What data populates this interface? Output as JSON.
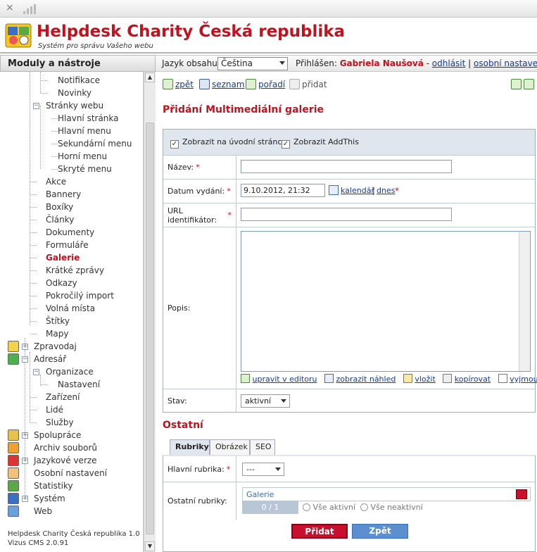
{
  "app": {
    "title": "Helpdesk Charity Česká republika",
    "subtitle": "Systém pro správu Vašeho webu"
  },
  "browser": {
    "close_glyph": "×"
  },
  "sidebar": {
    "header": "Moduly a nástroje",
    "items": [
      {
        "label": "Notifikace"
      },
      {
        "label": "Novinky"
      },
      {
        "label": "Stránky webu"
      },
      {
        "label": "Hlavní stránka"
      },
      {
        "label": "Hlavní menu"
      },
      {
        "label": "Sekundární menu"
      },
      {
        "label": "Horní menu"
      },
      {
        "label": "Skryté menu"
      },
      {
        "label": "Akce"
      },
      {
        "label": "Bannery"
      },
      {
        "label": "Boxíky"
      },
      {
        "label": "Články"
      },
      {
        "label": "Dokumenty"
      },
      {
        "label": "Formuláře"
      },
      {
        "label": "Galerie",
        "active": true
      },
      {
        "label": "Krátké zprávy"
      },
      {
        "label": "Odkazy"
      },
      {
        "label": "Pokročilý import"
      },
      {
        "label": "Volná místa"
      },
      {
        "label": "Štítky"
      },
      {
        "label": "Mapy"
      },
      {
        "label": "Zpravodaj"
      },
      {
        "label": "Adresář"
      },
      {
        "label": "Organizace"
      },
      {
        "label": "Nastavení"
      },
      {
        "label": "Zařízení"
      },
      {
        "label": "Lidé"
      },
      {
        "label": "Služby"
      },
      {
        "label": "Spolupráce"
      },
      {
        "label": "Archiv souborů"
      },
      {
        "label": "Jazykové verze"
      },
      {
        "label": "Osobní nastavení"
      },
      {
        "label": "Statistiky"
      },
      {
        "label": "Systém"
      },
      {
        "label": "Web"
      }
    ],
    "footer_line1": "Helpdesk Charity Česká republika 1.0",
    "footer_line2": "Vizus CMS 2.0.91"
  },
  "langbar": {
    "label": "Jazyk obsahu:",
    "selected": "Čeština",
    "logged_label": "Přihlášen:",
    "user": "Gabriela Naušová",
    "separator1": "-",
    "logout": "odhlásit",
    "separator2": "|",
    "settings": "osobní nastavení"
  },
  "toolbar": {
    "back": "zpět",
    "list": "seznam",
    "order": "pořadí",
    "add": "přidat"
  },
  "page_title": "Přidání Multimediální galerie",
  "form": {
    "show_home_label": "Zobrazit na úvodní stránce",
    "show_home_checked": true,
    "show_addthis_label": "Zobrazit AddThis",
    "show_addthis_checked": true,
    "name_label": "Název:",
    "name_value": "",
    "date_label": "Datum vydání:",
    "date_value": "9.10.2012, 21:32",
    "calendar_link": "kalendář",
    "date_sep": "|",
    "today_link": "dnes",
    "url_label": "URL identifikátor:",
    "url_value": "",
    "desc_label": "Popis:",
    "desc_value": "",
    "req_mark": "*",
    "editor_links": {
      "edit": "upravit v editoru",
      "preview": "zobrazit náhled",
      "paste": "vložit",
      "copy": "kopírovat",
      "cut": "vyjmout"
    },
    "state_label": "Stav:",
    "state_value": "aktivní"
  },
  "other": {
    "heading": "Ostatní",
    "tabs": [
      "Rubriky",
      "Obrázek",
      "SEO"
    ],
    "main_category_label": "Hlavní rubrika:",
    "main_category_value": "---",
    "other_categories_label": "Ostatní rubriky:",
    "other_categories_item": "Galerie",
    "counter": "0 / 1",
    "all_active": "Vše aktivní",
    "all_inactive": "Vše neaktivní"
  },
  "buttons": {
    "submit": "Přidat",
    "back": "Zpět"
  },
  "colors": {
    "brand_red": "#c1121f",
    "link_blue": "#1a3a8a",
    "submit_bg": "#c8102e",
    "back_bg": "#5b8fd0"
  }
}
